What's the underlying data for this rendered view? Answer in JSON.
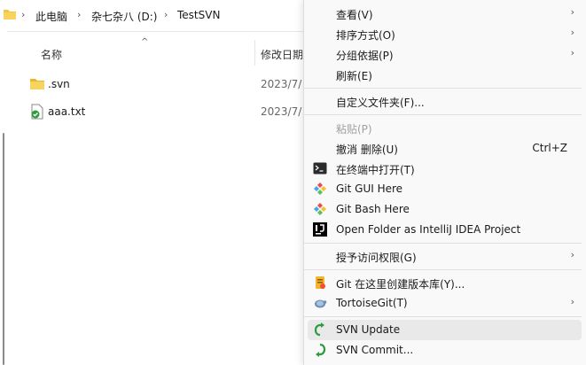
{
  "breadcrumb": {
    "this_pc": "此电脑",
    "drive": "杂七杂八 (D:)",
    "folder": "TestSVN"
  },
  "columns": {
    "name": "名称",
    "date": "修改日期"
  },
  "files": [
    {
      "name": ".svn",
      "date": "2023/7/",
      "icon": "folder-icon"
    },
    {
      "name": "aaa.txt",
      "date": "2023/7/",
      "icon": "svn-text-file-icon"
    }
  ],
  "menu": {
    "view": "查看(V)",
    "sort_by": "排序方式(O)",
    "group_by": "分组依据(P)",
    "refresh": "刷新(E)",
    "customize_folder": "自定义文件夹(F)...",
    "paste": "粘贴(P)",
    "undo_delete": "撤消 删除(U)",
    "undo_shortcut": "Ctrl+Z",
    "open_in_terminal": "在终端中打开(T)",
    "git_gui": "Git GUI Here",
    "git_bash": "Git Bash Here",
    "open_intellij": "Open Folder as IntelliJ IDEA Project",
    "grant_access": "授予访问权限(G)",
    "git_create_repo": "Git 在这里创建版本库(Y)...",
    "tortoisegit": "TortoiseGit(T)",
    "svn_update": "SVN Update",
    "svn_commit": "SVN Commit..."
  },
  "colors": {
    "menu_bg": "#f9f9f9",
    "hover_bg": "#e9e9e9",
    "folder_yellow": "#f4c542",
    "git_orange": "#f05033",
    "svn_green": "#2e9b3f"
  }
}
